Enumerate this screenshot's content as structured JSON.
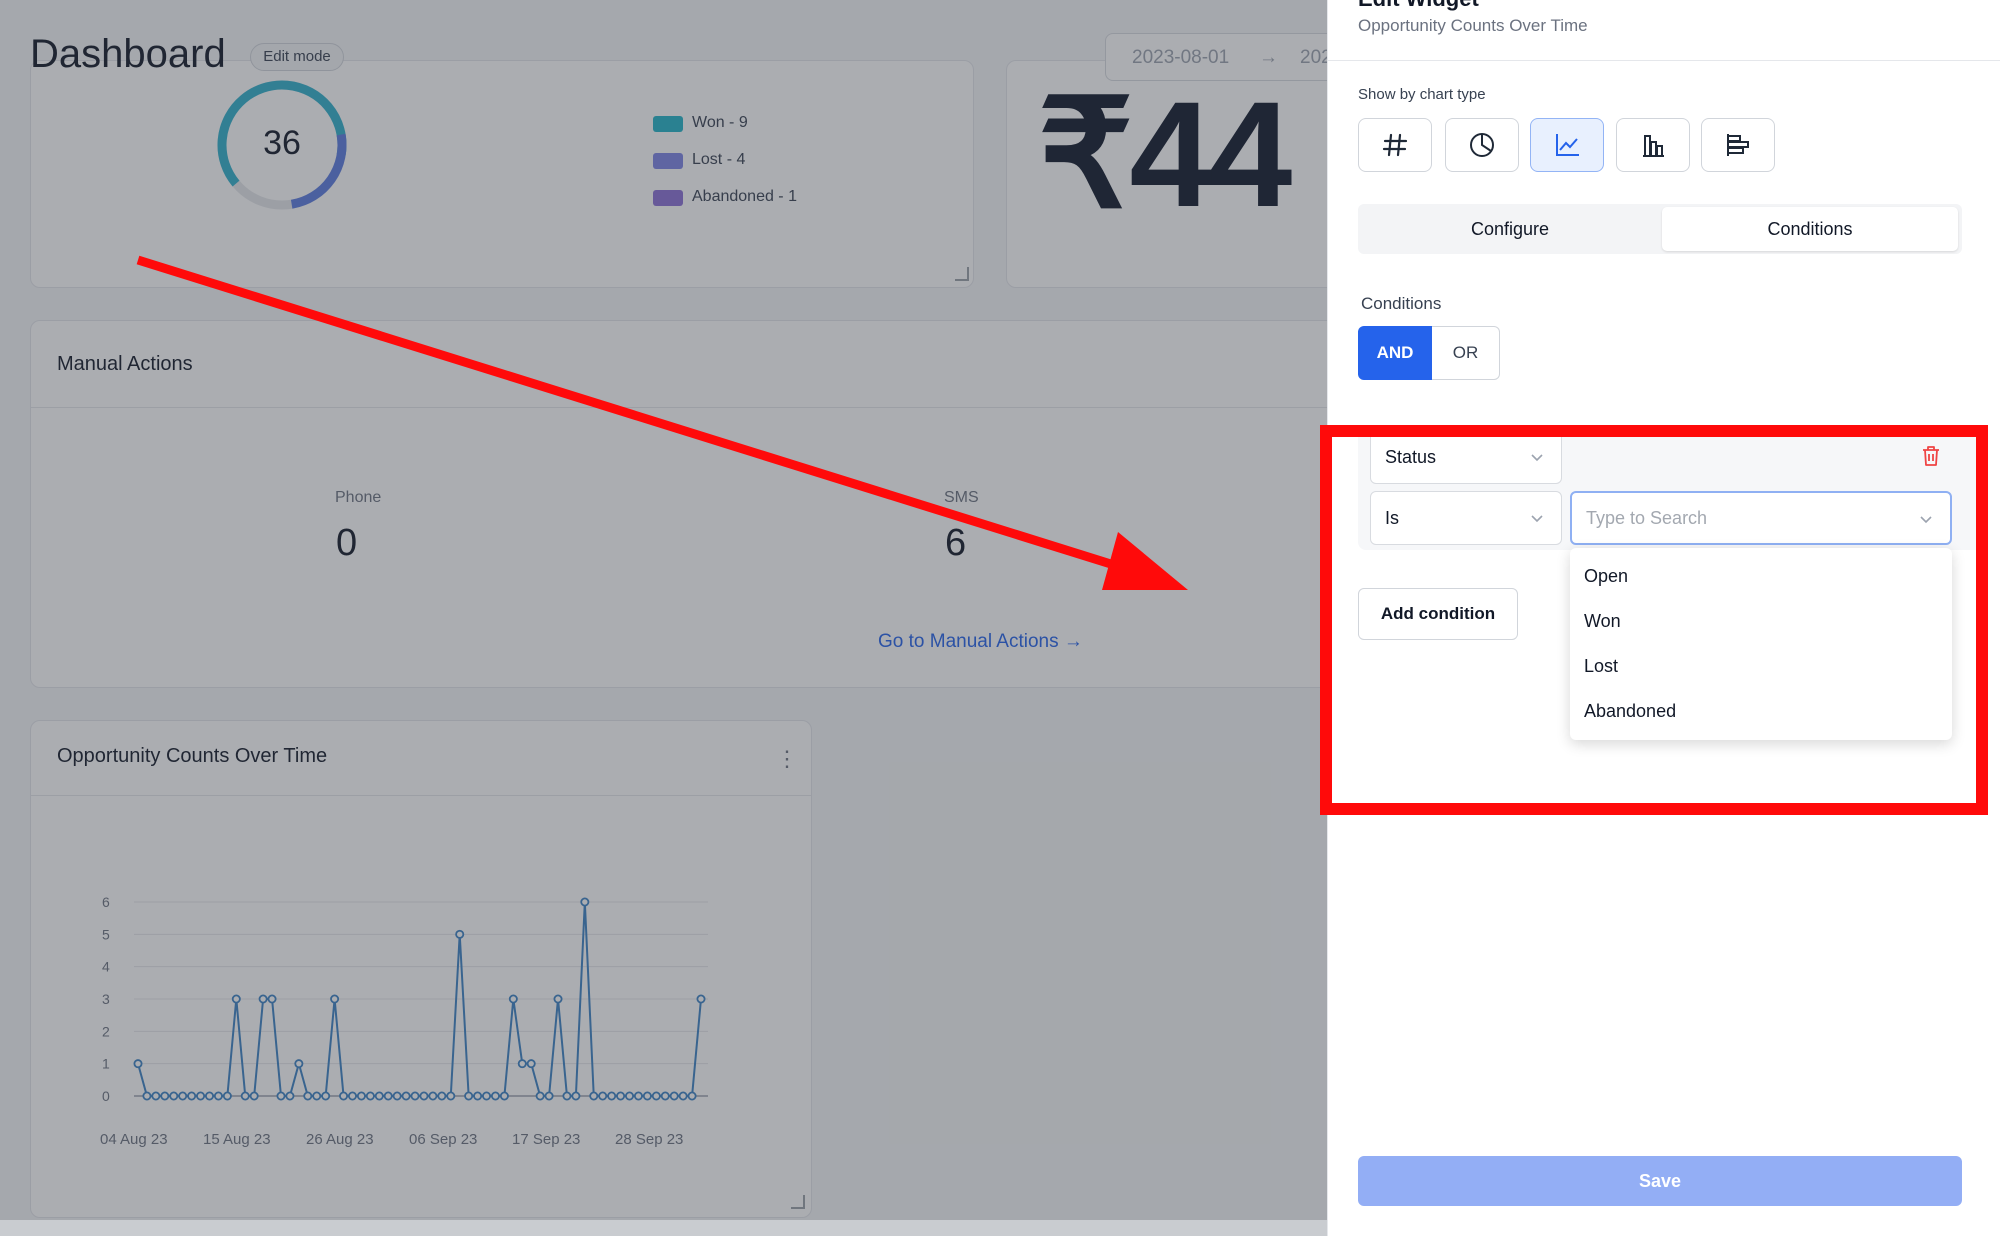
{
  "dashboard": {
    "title": "Dashboard",
    "edit_mode": "Edit mode",
    "date_from": "2023-08-01",
    "date_to_partial": "202",
    "donut": {
      "total": "36",
      "legend": [
        {
          "label": "Won - 9",
          "color": "#22b3c8"
        },
        {
          "label": "Lost - 4",
          "color": "#7c83e6"
        },
        {
          "label": "Abandoned - 1",
          "color": "#8b6fd6"
        }
      ]
    },
    "revenue_display": "₹44",
    "manual_actions": {
      "title": "Manual Actions",
      "phone_label": "Phone",
      "phone_value": "0",
      "sms_label": "SMS",
      "sms_value": "6",
      "link": "Go to Manual Actions →"
    },
    "chart_card_title": "Opportunity Counts Over Time",
    "kebab": "⋮"
  },
  "chart_data": {
    "type": "line",
    "title": "Opportunity Counts Over Time",
    "xlabel": "",
    "ylabel": "",
    "ylim": [
      0,
      6
    ],
    "yticks": [
      "0",
      "1",
      "2",
      "3",
      "4",
      "5",
      "6"
    ],
    "xticks": [
      "04 Aug 23",
      "15 Aug 23",
      "26 Aug 23",
      "06 Sep 23",
      "17 Sep 23",
      "28 Sep 23"
    ],
    "x_start": "2023-08-04",
    "series": [
      {
        "color": "#3b82c4",
        "values": [
          1,
          0,
          0,
          0,
          0,
          0,
          0,
          0,
          0,
          0,
          0,
          3,
          0,
          0,
          3,
          3,
          0,
          0,
          1,
          0,
          0,
          0,
          3,
          0,
          0,
          0,
          0,
          0,
          0,
          0,
          0,
          0,
          0,
          0,
          0,
          0,
          5,
          0,
          0,
          0,
          0,
          0,
          3,
          1,
          1,
          0,
          0,
          3,
          0,
          0,
          6,
          0,
          0,
          0,
          0,
          0,
          0,
          0,
          0,
          0,
          0,
          0,
          0,
          3
        ]
      }
    ]
  },
  "panel": {
    "heading": "Edit Widget",
    "subtitle": "Opportunity Counts Over Time",
    "chart_type_label": "Show by chart type",
    "chart_types": [
      "number-icon",
      "pie-icon",
      "line-chart-icon",
      "bar-chart-icon",
      "horizontal-bar-icon"
    ],
    "tab_configure": "Configure",
    "tab_conditions": "Conditions",
    "conditions_label": "Conditions",
    "and_label": "AND",
    "or_label": "OR",
    "field_select": "Status",
    "operator_select": "Is",
    "value_placeholder": "Type to Search",
    "add_condition": "Add condition",
    "options": [
      "Open",
      "Won",
      "Lost",
      "Abandoned"
    ],
    "save": "Save",
    "accent": "#2563eb"
  },
  "annotation": {
    "box_color": "#ff0a0a",
    "arrow_color": "#ff0a0a"
  }
}
